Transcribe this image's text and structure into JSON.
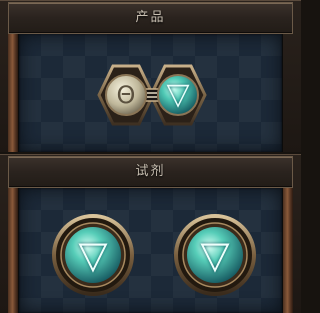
{
  "product_section": {
    "title": "产品",
    "items": [
      {
        "label": "Θ",
        "type": "locked"
      },
      {
        "label": "▽",
        "type": "water"
      }
    ]
  },
  "reagent_section": {
    "title": "试剂",
    "items": [
      {
        "label": "▽",
        "type": "water"
      },
      {
        "label": "▽",
        "type": "water"
      }
    ]
  }
}
